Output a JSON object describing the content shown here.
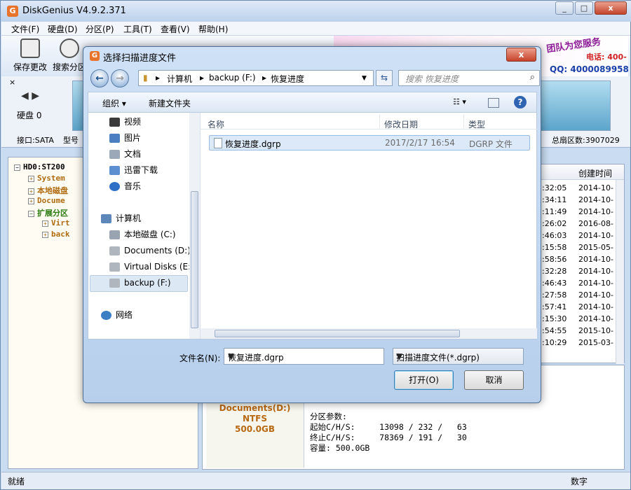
{
  "app": {
    "title": "DiskGenius V4.9.2.371",
    "icon_letter": "G",
    "win_controls": [
      "_",
      "□",
      "x"
    ]
  },
  "menu": [
    "文件(F)",
    "硬盘(D)",
    "分区(P)",
    "工具(T)",
    "查看(V)",
    "帮助(H)"
  ],
  "toolbar": {
    "save": "保存更改",
    "search": "搜索分区"
  },
  "banner": {
    "tag1": "团队为您服务",
    "tag2": "电话: 400-",
    "qq": "QQ: 4000089958"
  },
  "disk": {
    "label": "硬盘 0",
    "interface": "接口:SATA",
    "model": "型号",
    "total_sectors": "总扇区数:3907029"
  },
  "tree": [
    {
      "text": "HD0:ST200",
      "sign": "-",
      "indent": 0,
      "color": "#000000"
    },
    {
      "text": "System",
      "sign": "+",
      "indent": 1,
      "color": "#b06b10"
    },
    {
      "text": "本地磁盘",
      "sign": "+",
      "indent": 1,
      "color": "#b06b10"
    },
    {
      "text": "Docume",
      "sign": "+",
      "indent": 1,
      "color": "#b06b10"
    },
    {
      "text": "扩展分区",
      "sign": "-",
      "indent": 1,
      "color": "#2a7a10"
    },
    {
      "text": "Virt",
      "sign": "+",
      "indent": 2,
      "color": "#b06b10"
    },
    {
      "text": "back",
      "sign": "+",
      "indent": 2,
      "color": "#b06b10"
    }
  ],
  "file_table": {
    "created_header": "创建时间",
    "rows": [
      {
        "time": ":32:05",
        "created": "2014-10-"
      },
      {
        "time": ":34:11",
        "created": "2014-10-"
      },
      {
        "time": ":11:49",
        "created": "2014-10-"
      },
      {
        "time": ":26:02",
        "created": "2016-08-"
      },
      {
        "time": ":46:03",
        "created": "2014-10-"
      },
      {
        "time": ":15:58",
        "created": "2015-05-"
      },
      {
        "time": ":58:56",
        "created": "2014-10-"
      },
      {
        "time": ":32:28",
        "created": "2014-10-"
      },
      {
        "time": ":46:43",
        "created": "2014-10-"
      },
      {
        "time": ":27:58",
        "created": "2014-10-"
      },
      {
        "time": ":57:41",
        "created": "2014-10-"
      },
      {
        "time": ":15:30",
        "created": "2014-10-"
      },
      {
        "time": ":54:55",
        "created": "2015-10-"
      },
      {
        "time": ":10:29",
        "created": "2015-03-"
      }
    ]
  },
  "partition_card": {
    "name": "Documents(D:)",
    "fs": "NTFS",
    "size": "500.0GB"
  },
  "partition_params": {
    "title": "分区参数:",
    "start": "起始C/H/S:     13098 / 232 /   63",
    "end": "终止C/H/S:     78369 / 191 /   30",
    "capacity": "容量: 500.0GB"
  },
  "status": {
    "text": "就绪",
    "mode": "数字"
  },
  "dialog": {
    "title": "选择扫描进度文件",
    "close": "x",
    "path": [
      "计算机",
      "backup (F:)",
      "恢复进度"
    ],
    "search_placeholder": "搜索 恢复进度",
    "organize": "组织 ▾",
    "new_folder": "新建文件夹",
    "help": "?",
    "nav_items": [
      {
        "label": "视频",
        "color": "#3a3a3a"
      },
      {
        "label": "图片",
        "color": "#4a7fc2"
      },
      {
        "label": "文档",
        "color": "#9aa8b8"
      },
      {
        "label": "迅雷下载",
        "color": "#5b8fcf"
      },
      {
        "label": "音乐",
        "color": "#2f6fc8"
      }
    ],
    "computer": "计算机",
    "drives": [
      "本地磁盘 (C:)",
      "Documents (D:)",
      "Virtual Disks (E:",
      "backup (F:)"
    ],
    "network": "网络",
    "columns": [
      "名称",
      "修改日期",
      "类型"
    ],
    "file": {
      "name": "恢复进度.dgrp",
      "date": "2017/2/17 16:54",
      "type": "DGRP 文件"
    },
    "filename_label": "文件名(N):",
    "filename_value": "恢复进度.dgrp",
    "filter": "扫描进度文件(*.dgrp)",
    "open": "打开(O)",
    "cancel": "取消"
  },
  "colors": {
    "accent": "#3c7fb1",
    "selection": "#dce9f8",
    "app_bg": "#c9dcf2"
  }
}
